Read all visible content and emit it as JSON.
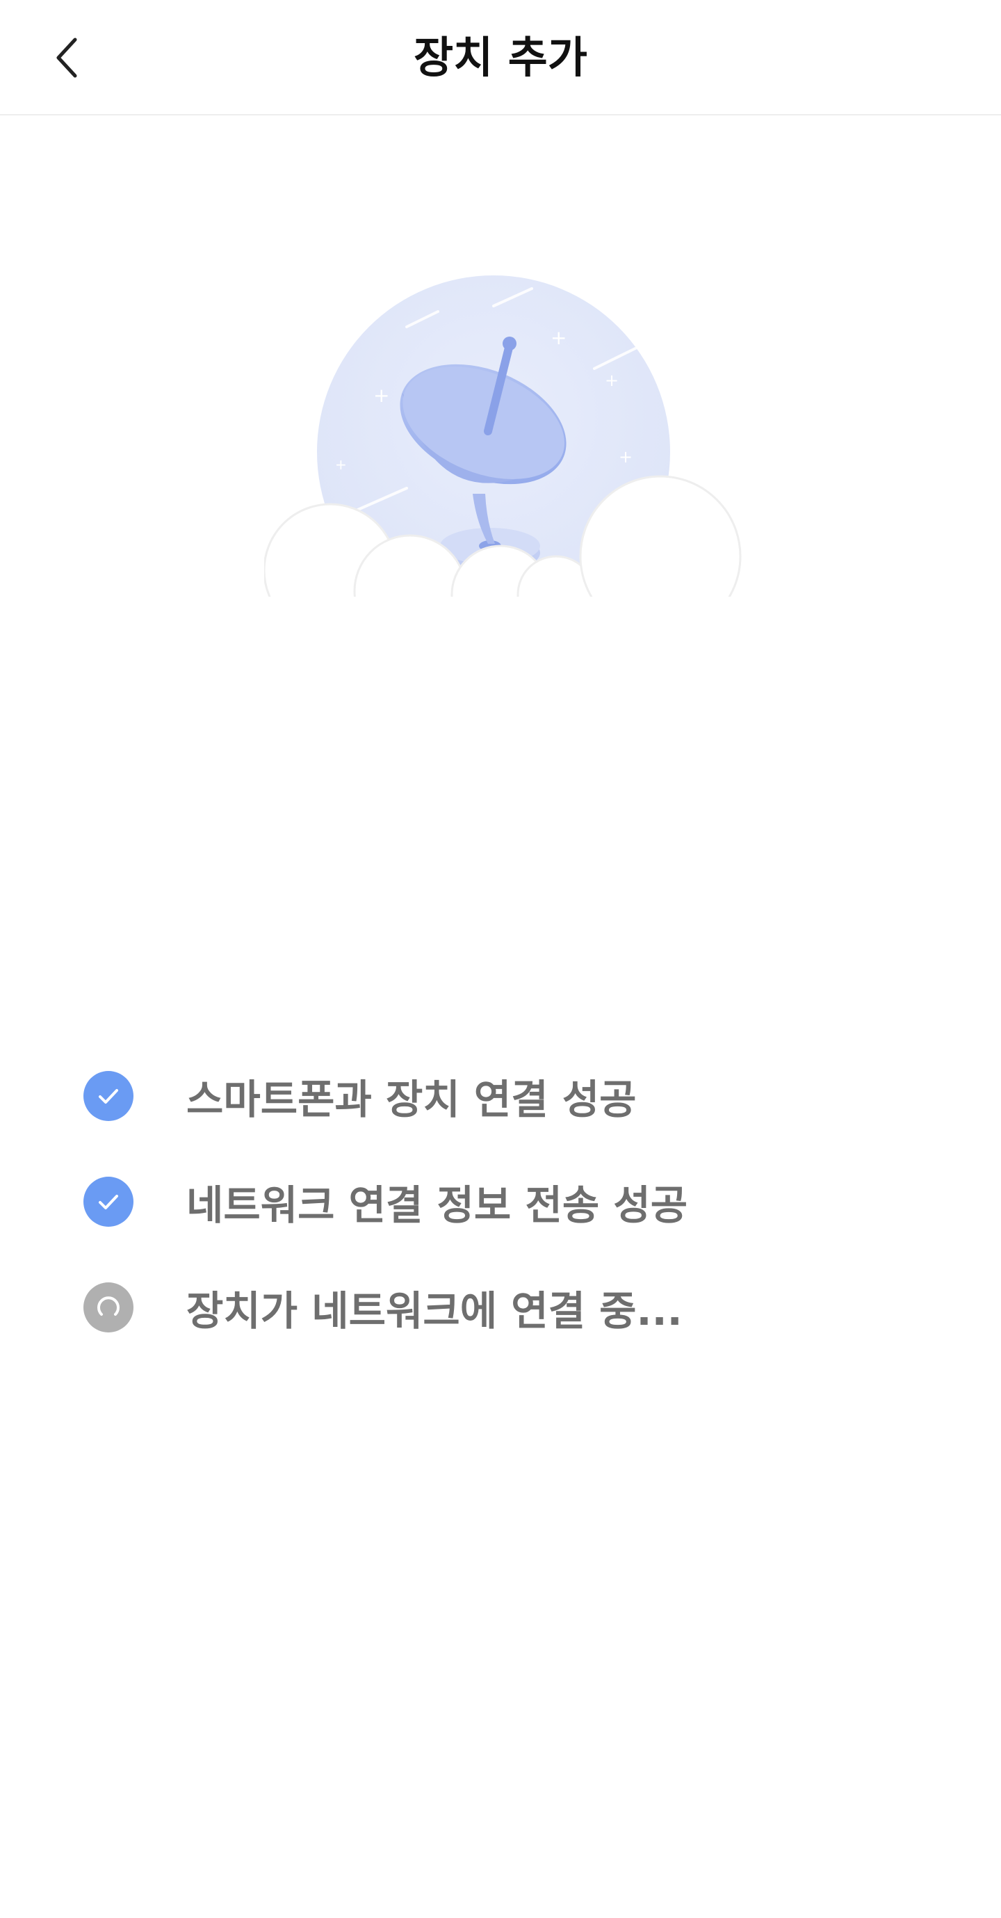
{
  "header": {
    "title": "장치 추가",
    "back_icon": "chevron-left-icon"
  },
  "illustration": {
    "icon": "satellite-dish-illustration",
    "accent_color": "#9fb4ee"
  },
  "steps": [
    {
      "label": "스마트폰과 장치 연결 성공",
      "status": "done",
      "icon": "check-circle-icon",
      "color": "#6a9bf3"
    },
    {
      "label": "네트워크 연결 정보 전송 성공",
      "status": "done",
      "icon": "check-circle-icon",
      "color": "#6a9bf3"
    },
    {
      "label": "장치가 네트워크에 연결 중...",
      "status": "in-progress",
      "icon": "loading-spinner-icon",
      "color": "#b0b0b0"
    }
  ]
}
